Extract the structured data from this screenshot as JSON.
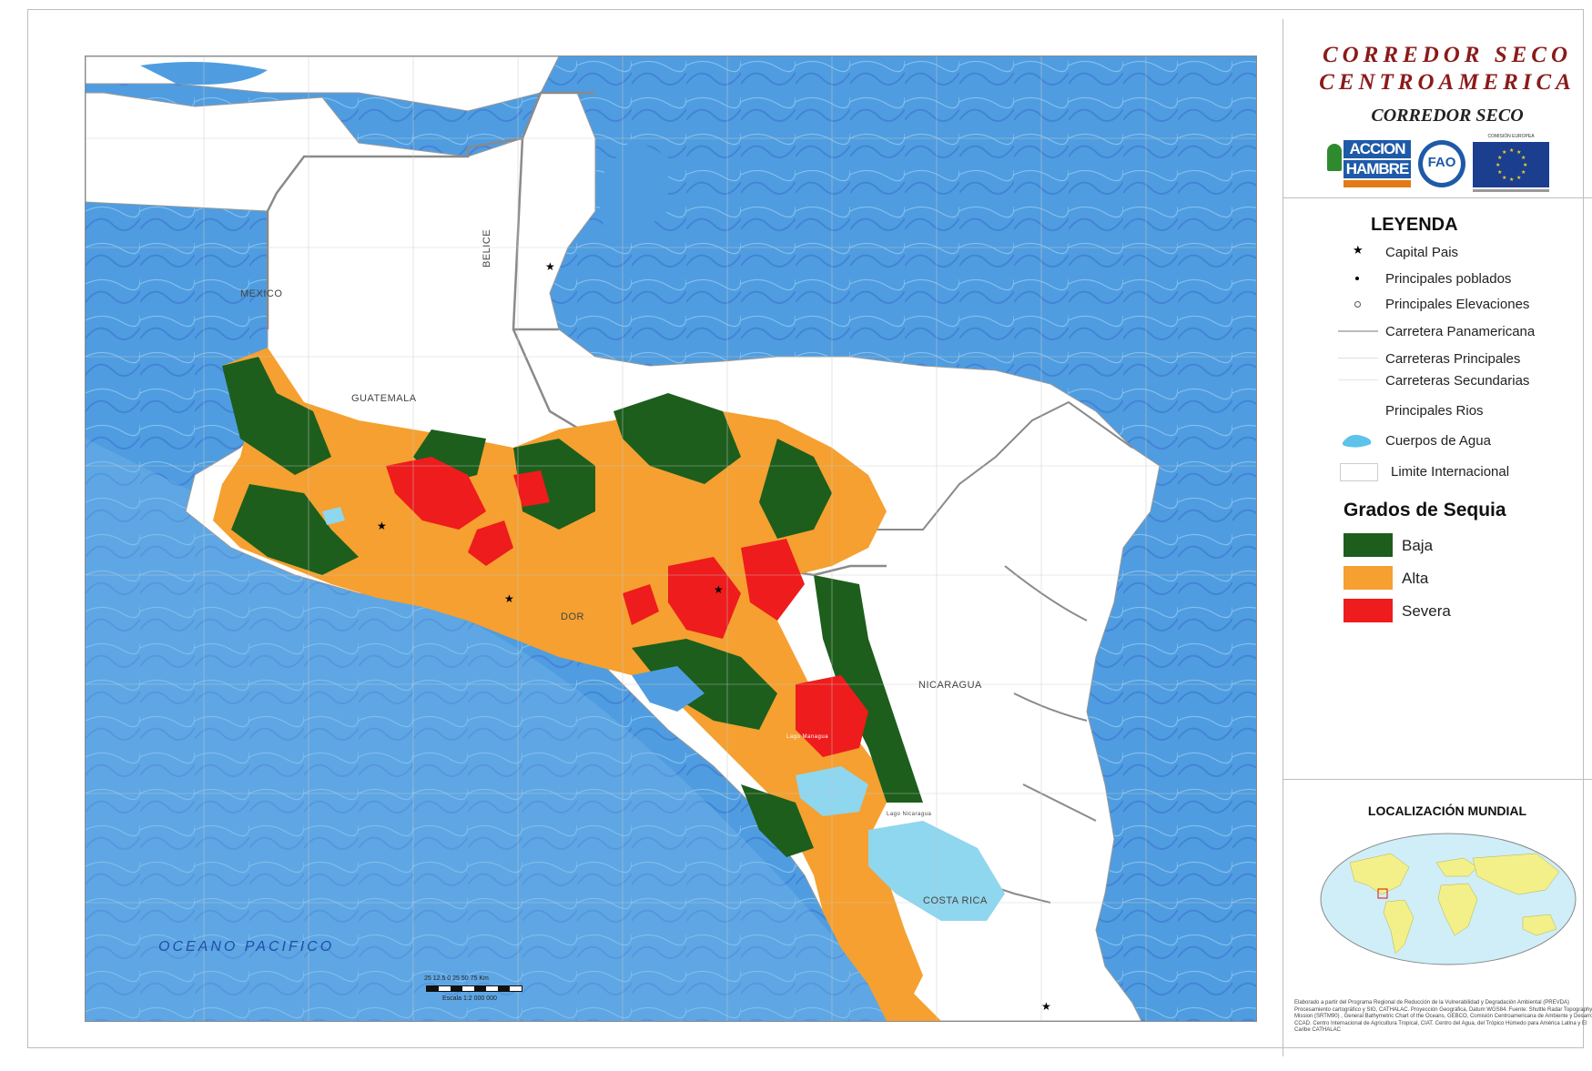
{
  "map": {
    "country_labels": {
      "mexico": "MEXICO",
      "belice": "BELICE",
      "guatemala": "GUATEMALA",
      "nicaragua": "NICARAGUA",
      "costa_rica": "COSTA  RICA",
      "el_salvador_fragment": "DOR"
    },
    "ocean_label": "OCEANO PACIFICO",
    "lake_labels": {
      "managua": "Lago Managua",
      "nicaragua": "Lago Nicaragua"
    },
    "scale": {
      "ticks": "25 12.5 0     25     50     75 Km",
      "caption": "Escala 1:2 000 000"
    },
    "colors": {
      "ocean": "#4f9de0",
      "land": "#ffffff",
      "baja": "#1d5e1d",
      "alta": "#f5a030",
      "severa": "#ee1c1c",
      "water_body": "#8fd6ef"
    }
  },
  "panel": {
    "title_line1": "CORREDOR SECO",
    "title_line2": "CENTROAMERICA",
    "subtitle": "CORREDOR SECO",
    "logos": {
      "accion_line1": "ACCION",
      "accion_line2": "HAMBRE",
      "fao": "FAO",
      "eu_header": "COMISIÓN EUROPEA"
    },
    "legend_title": "LEYENDA",
    "legend_items": [
      {
        "icon": "star-icon",
        "label": "Capital Pais"
      },
      {
        "icon": "dot-icon",
        "label": "Principales poblados"
      },
      {
        "icon": "elevation-icon",
        "label": "Principales Elevaciones"
      },
      {
        "icon": "line-icon",
        "label": "Carretera Panamericana"
      },
      {
        "icon": "line-icon",
        "label": "Carreteras Principales"
      },
      {
        "icon": "line-icon",
        "label": "Carreteras Secundarias"
      },
      {
        "icon": "river-icon",
        "label": "Principales Rios"
      },
      {
        "icon": "water-icon",
        "label": "Cuerpos de Agua"
      },
      {
        "icon": "boundary-icon",
        "label": "Limite Internacional"
      }
    ],
    "drought_title": "Grados de Sequia",
    "drought_classes": [
      {
        "label": "Baja",
        "color": "#1d5e1d"
      },
      {
        "label": "Alta",
        "color": "#f5a030"
      },
      {
        "label": "Severa",
        "color": "#ee1c1c"
      }
    ],
    "location_title": "LOCALIZACIÓN MUNDIAL",
    "credits": "Elaborado a partir del Programa Regional de Reducción de la Vulnerabilidad y Degradación Ambiental (PREVDA) Procesamiento cartográfico y SIG, CATHALAC. Proyección Geográfica, Datum WGS84. Fuente: Shuttle Radar Topography Mission (SRTM90) , General Bathymetric Chart of the Oceans, GEBCO, Comisión Centroamericana de Ambiente y Desarrollo, CCAD. Centro Internacional de Agricultura Tropical, CIAT. Centro del Agua, del Trópico Húmedo para América Latina y El Caribe CATHALAC"
  }
}
